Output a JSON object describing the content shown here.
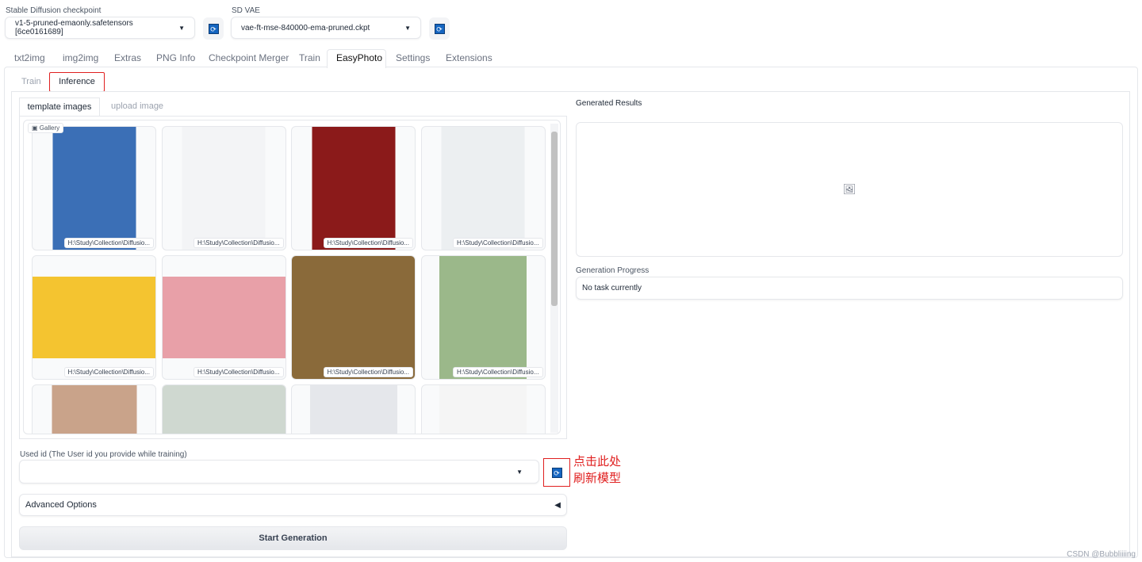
{
  "top": {
    "checkpoint_label": "Stable Diffusion checkpoint",
    "checkpoint_value": "v1-5-pruned-emaonly.safetensors [6ce0161689]",
    "vae_label": "SD VAE",
    "vae_value": "vae-ft-mse-840000-ema-pruned.ckpt"
  },
  "tabs": [
    "txt2img",
    "img2img",
    "Extras",
    "PNG Info",
    "Checkpoint Merger",
    "Train",
    "EasyPhoto",
    "Settings",
    "Extensions"
  ],
  "subtabs": [
    "Train",
    "Inference"
  ],
  "source_tabs": [
    "template images",
    "upload image"
  ],
  "gallery": {
    "label": "Gallery",
    "items": [
      {
        "caption": "H:\\Study\\Collection\\Diffusio...",
        "color": "#3b6fb6"
      },
      {
        "caption": "H:\\Study\\Collection\\Diffusio...",
        "color": "#f3f4f6"
      },
      {
        "caption": "H:\\Study\\Collection\\Diffusio...",
        "color": "#8b1a1a"
      },
      {
        "caption": "H:\\Study\\Collection\\Diffusio...",
        "color": "#eceff1"
      },
      {
        "caption": "H:\\Study\\Collection\\Diffusio...",
        "color": "#f4c430"
      },
      {
        "caption": "H:\\Study\\Collection\\Diffusio...",
        "color": "#e8a0a8"
      },
      {
        "caption": "H:\\Study\\Collection\\Diffusio...",
        "color": "#8a6a3a"
      },
      {
        "caption": "H:\\Study\\Collection\\Diffusio...",
        "color": "#9bb88a"
      },
      {
        "caption": "",
        "color": "#c9a38a"
      },
      {
        "caption": "",
        "color": "#cfd8d0"
      },
      {
        "caption": "",
        "color": "#e5e7eb"
      },
      {
        "caption": "",
        "color": "#f5f5f5"
      }
    ]
  },
  "user_id": {
    "label": "Used id (The User id you provide while training)",
    "value": ""
  },
  "annotation": [
    "点击此处",
    "刷新模型"
  ],
  "advanced_label": "Advanced Options",
  "start_label": "Start Generation",
  "results": {
    "label": "Generated Results",
    "progress_label": "Generation Progress",
    "progress_text": "No task currently"
  },
  "watermark": "CSDN @Bubbliiiing"
}
